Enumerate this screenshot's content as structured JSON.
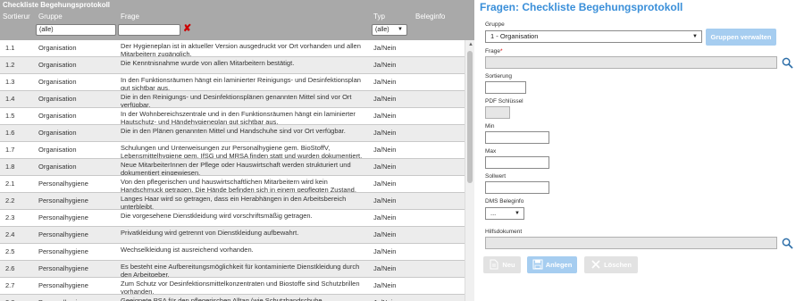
{
  "grid": {
    "title": "Checkliste Begehungsprotokoll",
    "headers": {
      "sort": "Sortierur",
      "group": "Gruppe",
      "question": "Frage",
      "type": "Typ",
      "info": "Beleginfo"
    },
    "filters": {
      "group": "(alle)",
      "question": "",
      "type": "(alle)"
    },
    "rows": [
      {
        "nr": "1.1",
        "group": "Organisation",
        "question": "Der Hygieneplan ist in aktueller Version ausgedruckt vor Ort vorhanden und allen Mitarbeitern zugänglich.",
        "type": "Ja/Nein"
      },
      {
        "nr": "1.2",
        "group": "Organisation",
        "question": "Die Kenntnisnahme wurde von allen Mitarbeitern bestätigt.",
        "type": "Ja/Nein"
      },
      {
        "nr": "1.3",
        "group": "Organisation",
        "question": "In den Funktionsräumen hängt ein laminierter Reinigungs- und Desinfektionsplan gut sichtbar aus.",
        "type": "Ja/Nein"
      },
      {
        "nr": "1.4",
        "group": "Organisation",
        "question": "Die in den Reinigungs- und Desinfektionsplänen genannten Mittel sind vor Ort verfügbar.",
        "type": "Ja/Nein"
      },
      {
        "nr": "1.5",
        "group": "Organisation",
        "question": "In der Wohnbereichszentrale und in den Funktionsräumen hängt ein laminierter Hautschutz- und Händehygieneplan gut sichtbar aus.",
        "type": "Ja/Nein"
      },
      {
        "nr": "1.6",
        "group": "Organisation",
        "question": "Die in den Plänen genannten Mittel und Handschuhe sind vor Ort verfügbar.",
        "type": "Ja/Nein"
      },
      {
        "nr": "1.7",
        "group": "Organisation",
        "question": "Schulungen und Unterweisungen zur Personalhygiene gem. BioStoffV, Lebensmittelhygiene gem. IfSG und MRSA finden statt und wurden dokumentiert.",
        "type": "Ja/Nein"
      },
      {
        "nr": "1.8",
        "group": "Organisation",
        "question": "Neue MitarbeiterInnen der Pflege oder Hauswirtschaft werden strukturiert und dokumentiert eingewiesen.",
        "type": "Ja/Nein"
      },
      {
        "nr": "2.1",
        "group": "Personalhygiene",
        "question": "Von den pflegerischen und hauswirtschaftlichen Mitarbeitern wird kein Handschmuck getragen. Die Hände befinden sich in einem gepflegten Zustand.",
        "type": "Ja/Nein"
      },
      {
        "nr": "2.2",
        "group": "Personalhygiene",
        "question": "Langes Haar wird so getragen, dass ein Herabhängen in den Arbeitsbereich unterbleibt.",
        "type": "Ja/Nein"
      },
      {
        "nr": "2.3",
        "group": "Personalhygiene",
        "question": "Die vorgesehene Dienstkleidung wird vorschriftsmäßig getragen.",
        "type": "Ja/Nein"
      },
      {
        "nr": "2.4",
        "group": "Personalhygiene",
        "question": "Privatkleidung wird getrennt von Dienstkleidung aufbewahrt.",
        "type": "Ja/Nein"
      },
      {
        "nr": "2.5",
        "group": "Personalhygiene",
        "question": "Wechselkleidung ist ausreichend vorhanden.",
        "type": "Ja/Nein"
      },
      {
        "nr": "2.6",
        "group": "Personalhygiene",
        "question": "Es besteht eine Aufbereitungsmöglichkeit für kontaminierte Dienstkleidung durch den Arbeitgeber.",
        "type": "Ja/Nein"
      },
      {
        "nr": "2.7",
        "group": "Personalhygiene",
        "question": "Zum Schutz vor Desinfektionsmittelkonzentraten und Biostoffe sind Schutzbrillen vorhanden.",
        "type": "Ja/Nein"
      },
      {
        "nr": "2.8",
        "group": "Personalhygiene",
        "question": "Geeignete PSA für den pflegerischen Alltag (wie Schutzhandschuhe",
        "type": "Ja/Nein"
      }
    ]
  },
  "form": {
    "title": "Fragen: Checkliste Begehungsprotokoll",
    "group_label": "Gruppe",
    "group_value": "1 - Organisation",
    "manage_groups": "Gruppen verwalten",
    "question_label": "Frage",
    "required_mark": "*",
    "sort_label": "Sortierung",
    "pdf_key_label": "PDF Schlüssel",
    "min_label": "Min",
    "max_label": "Max",
    "target_label": "Sollwert",
    "dms_label": "DMS Beleginfo",
    "dms_value": "...",
    "help_doc_label": "Hilfsdokument",
    "buttons": {
      "new": "Neu",
      "save": "Anlegen",
      "delete": "Löschen"
    }
  }
}
